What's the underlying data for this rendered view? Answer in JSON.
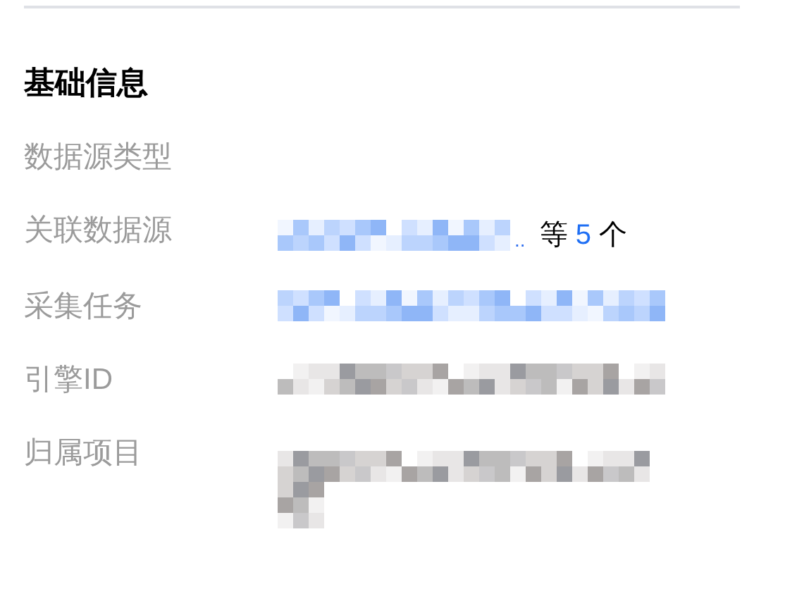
{
  "section": {
    "title": "基础信息"
  },
  "rows": [
    {
      "label": "数据源类型"
    },
    {
      "label": "关联数据源",
      "value": {
        "kind": "blurred_link",
        "ellipsis": "..",
        "more_prefix": "等",
        "more_count": "5",
        "more_suffix": "个"
      }
    },
    {
      "label": "采集任务",
      "value": {
        "kind": "blurred_link_long"
      }
    },
    {
      "label": "引擎ID",
      "value": {
        "kind": "blurred_text"
      }
    },
    {
      "label": "归属项目",
      "value": {
        "kind": "blurred_text_two_lines"
      }
    }
  ]
}
